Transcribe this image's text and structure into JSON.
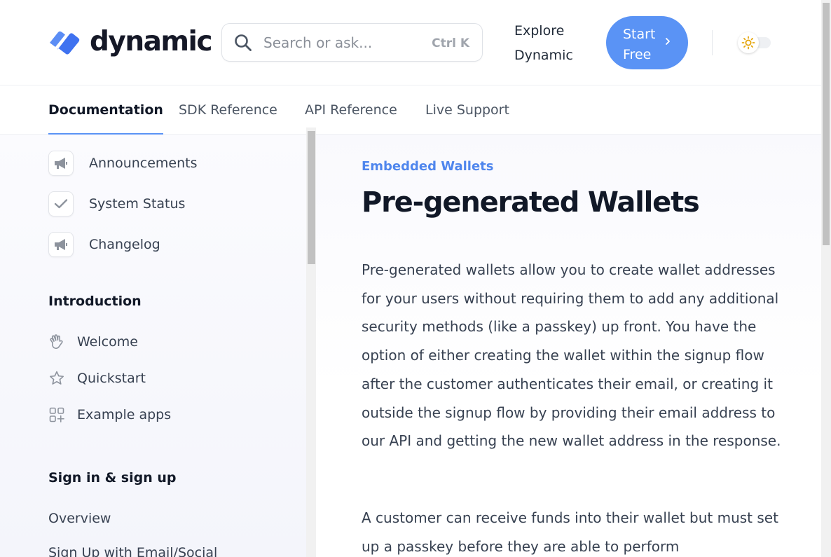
{
  "header": {
    "logo_text": "dynamic",
    "search": {
      "placeholder": "Search or ask...",
      "shortcut": "Ctrl K"
    },
    "explore_label": "Explore Dynamic",
    "start_button_label": "Start Free",
    "accent_color": "#5a93f5"
  },
  "tabs": [
    {
      "label": "Documentation",
      "active": true
    },
    {
      "label": "SDK Reference",
      "active": false
    },
    {
      "label": "API Reference",
      "active": false
    },
    {
      "label": "Live Support",
      "active": false
    }
  ],
  "sidebar": {
    "top_links": [
      {
        "label": "Announcements",
        "icon": "megaphone-icon"
      },
      {
        "label": "System Status",
        "icon": "check-icon"
      },
      {
        "label": "Changelog",
        "icon": "megaphone-icon"
      }
    ],
    "sections": [
      {
        "heading": "Introduction",
        "items": [
          {
            "label": "Welcome",
            "icon": "waving-hand-icon"
          },
          {
            "label": "Quickstart",
            "icon": "star-icon"
          },
          {
            "label": "Example apps",
            "icon": "grid-plus-icon"
          }
        ]
      },
      {
        "heading": "Sign in & sign up",
        "items": [
          {
            "label": "Overview"
          },
          {
            "label": "Sign Up with Email/Social"
          }
        ]
      }
    ]
  },
  "main": {
    "eyebrow": "Embedded Wallets",
    "title": "Pre-generated Wallets",
    "paragraphs": [
      "Pre-generated wallets allow you to create wallet addresses for your users without requiring them to add any additional security methods (like a passkey) up front. You have the option of either creating the wallet within the signup flow after the customer authenticates their email, or creating it outside the signup flow by providing their email address to our API and getting the new wallet address in the response.",
      "A customer can receive funds into their wallet but must set up a passkey before they are able to perform"
    ]
  }
}
